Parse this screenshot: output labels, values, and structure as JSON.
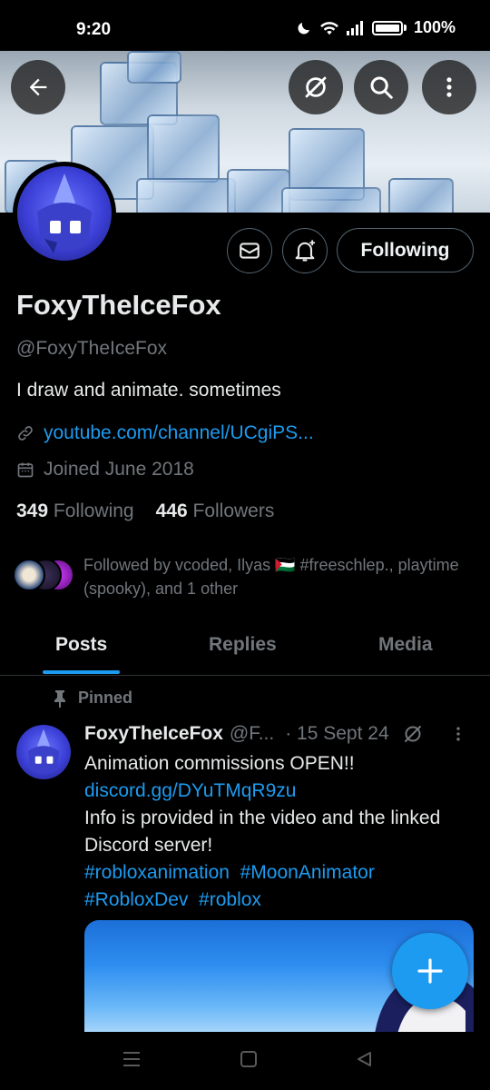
{
  "status_bar": {
    "time": "9:20",
    "battery": "100%"
  },
  "header": {
    "back_icon": "arrow-left-icon",
    "grok_icon": "slash-circle-icon",
    "search_icon": "search-icon",
    "more_icon": "more-vertical-icon"
  },
  "profile": {
    "display_name": "FoxyTheIceFox",
    "handle": "@FoxyTheIceFox",
    "bio": "I draw and animate. sometimes",
    "link": "youtube.com/channel/UCgiPS...",
    "joined": "Joined June 2018",
    "following_count": "349",
    "following_label": "Following",
    "followers_count": "446",
    "followers_label": "Followers",
    "followed_by": "Followed by vcoded, Ilyas 🇵🇸 #freeschlep., playtime (spooky), and 1 other",
    "follow_button": "Following"
  },
  "tabs": [
    {
      "label": "Posts",
      "active": true
    },
    {
      "label": "Replies",
      "active": false
    },
    {
      "label": "Media",
      "active": false
    }
  ],
  "pinned_post": {
    "pinned_label": "Pinned",
    "author_name": "FoxyTheIceFox",
    "author_handle": "@F...",
    "date": "· 15 Sept 24",
    "line1": "Animation commissions OPEN!!",
    "link": "discord.gg/DYuTMqR9zu",
    "line2": "Info is provided in the video and the linked Discord server!",
    "hashtags_1": "#robloxanimation  #MoonAnimator",
    "hashtags_2": "#RobloxDev  #roblox"
  },
  "colors": {
    "accent": "#1d9bf0",
    "text_primary": "#e7e9ea",
    "text_muted": "#71767b",
    "border": "#2f3336",
    "background": "#000000"
  }
}
